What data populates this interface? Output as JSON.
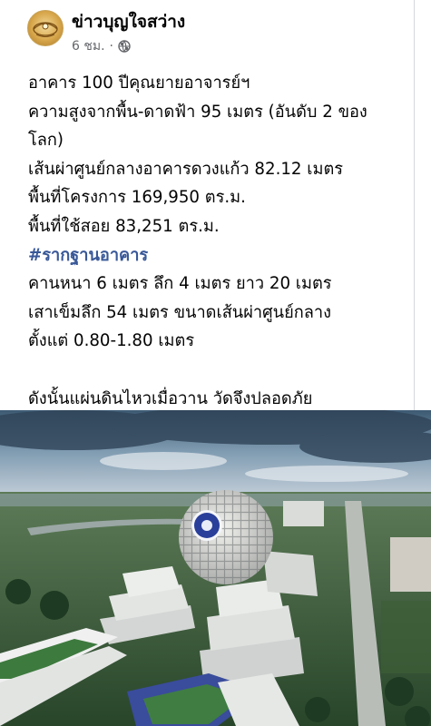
{
  "post": {
    "page_name": "ข่าวบุญใจสว่าง",
    "timestamp": "6 ชม.",
    "separator": "·",
    "privacy_icon": "globe-icon",
    "avatar_icon": "temple-logo-icon"
  },
  "body": {
    "line1": "อาคาร 100 ปีคุณยายอาจารย์ฯ",
    "line2": "ความสูงจากพื้น-ดาดฟ้า 95 เมตร (อันดับ 2 ของ",
    "line3": "โลก)",
    "line4": "เส้นผ่าศูนย์กลางอาคารดวงแก้ว 82.12 เมตร",
    "line5": "พื้นที่โครงการ 169,950 ตร.ม.",
    "line6": "พื้นที่ใช้สอย 83,251 ตร.ม.",
    "hashtag": "#รากฐานอาคาร",
    "line7": "คานหนา 6 เมตร ลึก 4 เมตร ยาว 20 เมตร",
    "line8": "เสาเข็มลึก 54 เมตร ขนาดเส้นผ่าศูนย์กลาง",
    "line9": "ตั้งแต่ 0.80-1.80 เมตร",
    "line10": "ดังนั้นแผ่นดินไหวเมื่อวาน วัดจึงปลอดภัย"
  },
  "colors": {
    "text": "#050505",
    "meta": "#65676b",
    "hashtag": "#385898"
  },
  "photo": {
    "subject": "aerial-photo-100-year-building-dome"
  }
}
